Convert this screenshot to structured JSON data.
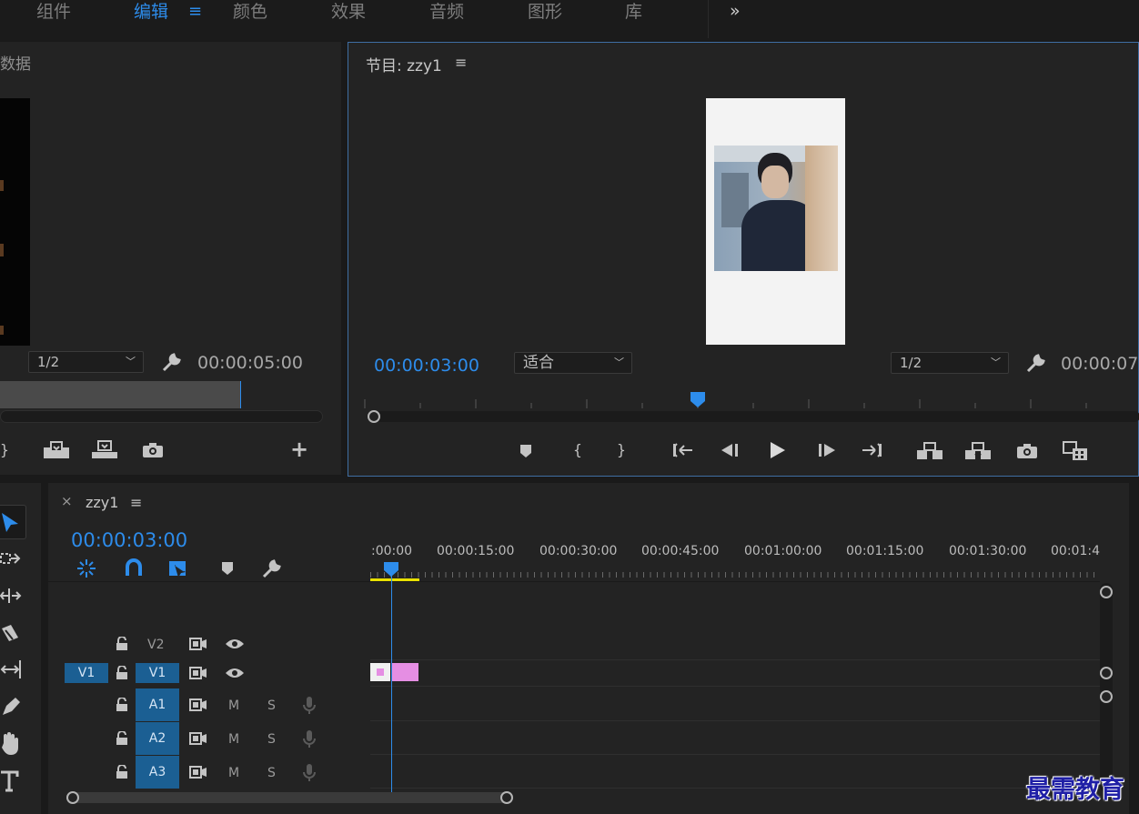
{
  "workspaces": {
    "tabs": [
      "组件",
      "编辑",
      "颜色",
      "效果",
      "音频",
      "图形",
      "库"
    ],
    "active_index": 1,
    "more": "»"
  },
  "source": {
    "title": "数据",
    "zoom": "1/2",
    "timecode": "00:00:05:00"
  },
  "program": {
    "title": "节目: zzy1",
    "current_tc": "00:00:03:00",
    "fit": "适合",
    "zoom": "1/2",
    "duration_tc": "00:00:07"
  },
  "timeline": {
    "tab": "zzy1",
    "close": "×",
    "current_tc": "00:00:03:00",
    "ruler_labels": [
      ":00:00",
      "00:00:15:00",
      "00:00:30:00",
      "00:00:45:00",
      "00:01:00:00",
      "00:01:15:00",
      "00:01:30:00",
      "00:01:4"
    ],
    "tracks": {
      "v2": {
        "label": "V2"
      },
      "v1": {
        "source": "V1",
        "label": "V1"
      },
      "a1": {
        "label": "A1",
        "mute": "M",
        "solo": "S"
      },
      "a2": {
        "label": "A2",
        "mute": "M",
        "solo": "S"
      },
      "a3": {
        "label": "A3",
        "mute": "M",
        "solo": "S"
      }
    }
  },
  "watermark": "最需教育",
  "colors": {
    "accent": "#2d8ceb",
    "clip": "#e58ee3",
    "track_target": "#1b5f93",
    "work_area": "#e8e000"
  }
}
